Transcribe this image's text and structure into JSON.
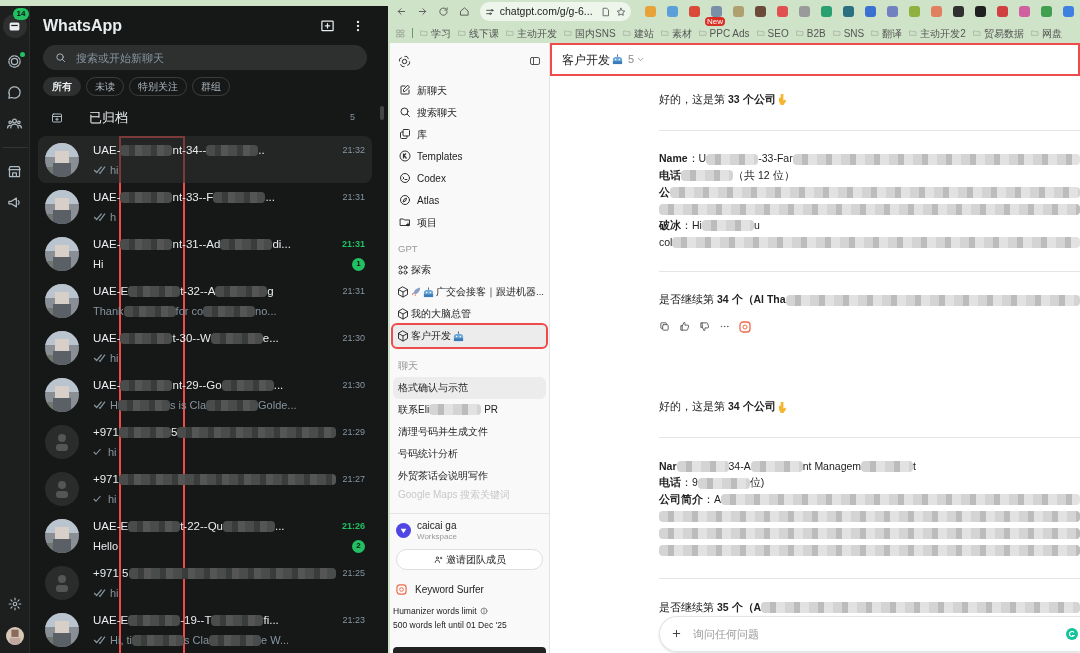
{
  "whatsapp": {
    "rail": {
      "chats_badge": "14",
      "status_dot": true
    },
    "title": "WhatsApp",
    "search": {
      "placeholder": "搜索或开始新聊天"
    },
    "filters": [
      {
        "label": "所有",
        "selected": true
      },
      {
        "label": "未读",
        "selected": false
      },
      {
        "label": "特别关注",
        "selected": false
      },
      {
        "label": "群组",
        "selected": false
      }
    ],
    "archived": {
      "label": "已归档",
      "count": "5"
    },
    "highlight_column": true,
    "chats": [
      {
        "photo": true,
        "selected": true,
        "name": [
          {
            "kind": "text",
            "text": "UAE-"
          },
          {
            "kind": "blur"
          },
          {
            "kind": "text",
            "text": "nt-34--"
          },
          {
            "kind": "blur"
          },
          {
            "kind": "text",
            "text": ".."
          }
        ],
        "time": "21:32",
        "unread": false,
        "tick": true,
        "double_tick": true,
        "preview": [
          {
            "kind": "text",
            "text": "hi"
          }
        ]
      },
      {
        "photo": true,
        "selected": false,
        "name": [
          {
            "kind": "text",
            "text": "UAE-"
          },
          {
            "kind": "blur"
          },
          {
            "kind": "text",
            "text": "nt-33--F"
          },
          {
            "kind": "blur"
          },
          {
            "kind": "text",
            "text": "..."
          }
        ],
        "time": "21:31",
        "unread": false,
        "tick": true,
        "double_tick": true,
        "preview": [
          {
            "kind": "text",
            "text": "h"
          }
        ]
      },
      {
        "photo": true,
        "selected": false,
        "name": [
          {
            "kind": "text",
            "text": "UAE-"
          },
          {
            "kind": "blur"
          },
          {
            "kind": "text",
            "text": "nt-31--Ad"
          },
          {
            "kind": "blur"
          },
          {
            "kind": "text",
            "text": "di..."
          }
        ],
        "time": "21:31",
        "unread": true,
        "badge": "1",
        "tick": false,
        "preview": [
          {
            "kind": "text",
            "text": "Hi"
          }
        ]
      },
      {
        "photo": true,
        "selected": false,
        "name": [
          {
            "kind": "text",
            "text": "UAE-E"
          },
          {
            "kind": "blur"
          },
          {
            "kind": "text",
            "text": "t-32--A"
          },
          {
            "kind": "blur"
          },
          {
            "kind": "text",
            "text": "g"
          }
        ],
        "time": "21:31",
        "unread": false,
        "tick": false,
        "preview": [
          {
            "kind": "text",
            "text": "Thank"
          },
          {
            "kind": "blur"
          },
          {
            "kind": "text",
            "text": "for co"
          },
          {
            "kind": "blur"
          },
          {
            "kind": "text",
            "text": "no..."
          }
        ]
      },
      {
        "photo": true,
        "selected": false,
        "name": [
          {
            "kind": "text",
            "text": "UAE-"
          },
          {
            "kind": "blur"
          },
          {
            "kind": "text",
            "text": "t-30--W"
          },
          {
            "kind": "blur"
          },
          {
            "kind": "text",
            "text": "e..."
          }
        ],
        "time": "21:30",
        "unread": false,
        "tick": true,
        "double_tick": true,
        "preview": [
          {
            "kind": "text",
            "text": "hi"
          }
        ]
      },
      {
        "photo": true,
        "selected": false,
        "name": [
          {
            "kind": "text",
            "text": "UAE-"
          },
          {
            "kind": "blur"
          },
          {
            "kind": "text",
            "text": "nt-29--Go"
          },
          {
            "kind": "blur"
          },
          {
            "kind": "text",
            "text": "..."
          }
        ],
        "time": "21:30",
        "unread": false,
        "tick": true,
        "double_tick": true,
        "preview": [
          {
            "kind": "text",
            "text": "H"
          },
          {
            "kind": "blur"
          },
          {
            "kind": "text",
            "text": "s is Cla"
          },
          {
            "kind": "blur"
          },
          {
            "kind": "text",
            "text": "Golde..."
          }
        ]
      },
      {
        "photo": false,
        "selected": false,
        "name": [
          {
            "kind": "text",
            "text": "+971"
          },
          {
            "kind": "blur"
          },
          {
            "kind": "text",
            "text": "5"
          },
          {
            "kind": "blur"
          }
        ],
        "time": "21:29",
        "unread": false,
        "tick": true,
        "double_tick": false,
        "preview": [
          {
            "kind": "text",
            "text": "hi"
          }
        ]
      },
      {
        "photo": false,
        "selected": false,
        "name": [
          {
            "kind": "text",
            "text": "+971"
          },
          {
            "kind": "blur"
          }
        ],
        "time": "21:27",
        "unread": false,
        "tick": true,
        "double_tick": false,
        "preview": [
          {
            "kind": "text",
            "text": "hi"
          }
        ]
      },
      {
        "photo": true,
        "selected": false,
        "name": [
          {
            "kind": "text",
            "text": "UAE-E"
          },
          {
            "kind": "blur"
          },
          {
            "kind": "text",
            "text": "t-22--Qu"
          },
          {
            "kind": "blur"
          },
          {
            "kind": "text",
            "text": "..."
          }
        ],
        "time": "21:26",
        "unread": true,
        "badge": "2",
        "tick": false,
        "preview": [
          {
            "kind": "text",
            "text": "Hello"
          }
        ]
      },
      {
        "photo": false,
        "selected": false,
        "name": [
          {
            "kind": "text",
            "text": "+971 5"
          },
          {
            "kind": "blur"
          }
        ],
        "time": "21:25",
        "unread": false,
        "tick": true,
        "double_tick": true,
        "preview": [
          {
            "kind": "text",
            "text": "hi"
          }
        ]
      },
      {
        "photo": true,
        "selected": false,
        "name": [
          {
            "kind": "text",
            "text": "UAE-E"
          },
          {
            "kind": "blur"
          },
          {
            "kind": "text",
            "text": "-19--T"
          },
          {
            "kind": "blur"
          },
          {
            "kind": "text",
            "text": "fi..."
          }
        ],
        "time": "21:23",
        "unread": false,
        "tick": true,
        "double_tick": true,
        "preview": [
          {
            "kind": "text",
            "text": "Hi, ti"
          },
          {
            "kind": "blur"
          },
          {
            "kind": "text",
            "text": "s Cla"
          },
          {
            "kind": "blur"
          },
          {
            "kind": "text",
            "text": "e W..."
          }
        ]
      }
    ]
  },
  "browser": {
    "url": "chatgpt.com/g/g-6...",
    "extensions": [
      {
        "color": "#e8a23a"
      },
      {
        "color": "#5aa0d8"
      },
      {
        "color": "#d94a3a"
      },
      {
        "color": "#7a8fa8",
        "badge": "New"
      },
      {
        "color": "#b0a070"
      },
      {
        "color": "#6b4a3a"
      },
      {
        "color": "#e05050"
      },
      {
        "color": "#9a9a9a"
      },
      {
        "color": "#2aa070"
      },
      {
        "color": "#2a7080"
      },
      {
        "color": "#3a70d0"
      },
      {
        "color": "#7080c0"
      },
      {
        "color": "#90b040"
      },
      {
        "color": "#e08060"
      },
      {
        "color": "#303030"
      },
      {
        "color": "#202020"
      },
      {
        "color": "#d04040"
      },
      {
        "color": "#d060a0"
      },
      {
        "color": "#40a050"
      },
      {
        "color": "#4080e0"
      }
    ],
    "bookmarks": [
      "学习",
      "线下课",
      "主动开发",
      "国内SNS",
      "建站",
      "素材",
      "PPC Ads",
      "SEO",
      "B2B",
      "SNS",
      "翻译",
      "主动开发2",
      "贸易数据",
      "网盘"
    ]
  },
  "chatgpt": {
    "sidebar": {
      "nav": [
        {
          "kind": "pencil",
          "label": "新聊天"
        },
        {
          "kind": "search",
          "label": "搜索聊天"
        },
        {
          "kind": "library",
          "label": "库"
        },
        {
          "kind": "k",
          "label": "Templates"
        },
        {
          "kind": "terminal",
          "label": "Codex"
        },
        {
          "kind": "compass",
          "label": "Atlas"
        },
        {
          "kind": "folder",
          "label": "项目"
        }
      ],
      "gpt_heading": "GPT",
      "gpts": [
        {
          "kind": "grid",
          "label": "探索",
          "selected": false,
          "highlighted": false
        },
        {
          "kind": "cube-rocket",
          "label": "广交会接客｜跟进机器...",
          "selected": false,
          "highlighted": false
        },
        {
          "kind": "cube",
          "label": "我的大脑总管",
          "selected": false,
          "highlighted": false
        },
        {
          "kind": "cube-robot",
          "label": "客户开发",
          "selected": true,
          "highlighted": true
        }
      ],
      "chats_heading": "聊天",
      "chats": [
        {
          "label": "格式确认与示范",
          "selected": true,
          "faded": false
        },
        {
          "label": "联系Eli",
          "tail": "PR",
          "selected": false,
          "faded": false
        },
        {
          "label": "清理号码并生成文件",
          "selected": false,
          "faded": false
        },
        {
          "label": "号码统计分析",
          "selected": false,
          "faded": false
        },
        {
          "label": "外贸茶话会说明写作",
          "selected": false,
          "faded": false
        },
        {
          "label": "Google Maps 搜索关键词",
          "selected": false,
          "faded": true
        }
      ],
      "account": {
        "name": "caicai ga",
        "plan": "Workspace"
      },
      "invite_button": "邀请团队成员",
      "keyword_surfer": "Keyword Surfer",
      "humanizer": {
        "title": "Humanizer words limit",
        "note": "500 words left until 01 Dec '25"
      }
    },
    "header": {
      "title": "客户开发",
      "version": "5",
      "highlighted": true
    },
    "messages": [
      {
        "kind": "text",
        "text": "好的，这是第 **33 个公司**",
        "pointer": true
      },
      {
        "kind": "rule"
      },
      {
        "kind": "line",
        "segments": [
          {
            "kind": "text",
            "text": "**Name**：U"
          },
          {
            "kind": "blur"
          },
          {
            "kind": "text",
            "text": "-33-Far"
          },
          {
            "kind": "blur"
          }
        ]
      },
      {
        "kind": "line",
        "segments": [
          {
            "kind": "text",
            "text": "**电话**"
          },
          {
            "kind": "blur"
          },
          {
            "kind": "text",
            "text": "（共 12 位）"
          }
        ]
      },
      {
        "kind": "line",
        "segments": [
          {
            "kind": "text",
            "text": "**公**"
          },
          {
            "kind": "blur"
          }
        ]
      },
      {
        "kind": "line",
        "segments": [
          {
            "kind": "blur"
          }
        ]
      },
      {
        "kind": "line",
        "segments": [
          {
            "kind": "text",
            "text": "**破冰**：Hi"
          },
          {
            "kind": "blur"
          },
          {
            "kind": "text",
            "text": "u"
          }
        ]
      },
      {
        "kind": "line",
        "segments": [
          {
            "kind": "text",
            "text": "col"
          },
          {
            "kind": "blur"
          }
        ]
      },
      {
        "kind": "rule"
      },
      {
        "kind": "line",
        "segments": [
          {
            "kind": "text",
            "text": "是否继续第 **34 个（Al Tha**"
          },
          {
            "kind": "blur"
          }
        ]
      },
      {
        "kind": "actions"
      },
      {
        "kind": "gap"
      },
      {
        "kind": "text",
        "text": "好的，这是第 **34 个公司**",
        "pointer": true
      },
      {
        "kind": "rule"
      },
      {
        "kind": "line",
        "segments": [
          {
            "kind": "text",
            "text": "**Nar**"
          },
          {
            "kind": "blur"
          },
          {
            "kind": "text",
            "text": "34-A"
          },
          {
            "kind": "blur"
          },
          {
            "kind": "text",
            "text": "nt Managem"
          },
          {
            "kind": "blur"
          },
          {
            "kind": "text",
            "text": "t"
          }
        ]
      },
      {
        "kind": "line",
        "segments": [
          {
            "kind": "text",
            "text": "**电话**：9"
          },
          {
            "kind": "blur"
          },
          {
            "kind": "text",
            "text": "位)"
          }
        ]
      },
      {
        "kind": "line",
        "segments": [
          {
            "kind": "text",
            "text": "**公司简介**：A"
          },
          {
            "kind": "blur"
          }
        ]
      },
      {
        "kind": "line",
        "segments": [
          {
            "kind": "blur"
          }
        ]
      },
      {
        "kind": "line",
        "segments": [
          {
            "kind": "blur"
          }
        ]
      },
      {
        "kind": "line",
        "segments": [
          {
            "kind": "blur"
          }
        ]
      },
      {
        "kind": "rule"
      },
      {
        "kind": "line",
        "segments": [
          {
            "kind": "text",
            "text": "是否继续第 **35 个（A**"
          },
          {
            "kind": "blur"
          }
        ]
      }
    ],
    "composer": {
      "placeholder": "询问任何问题"
    }
  }
}
